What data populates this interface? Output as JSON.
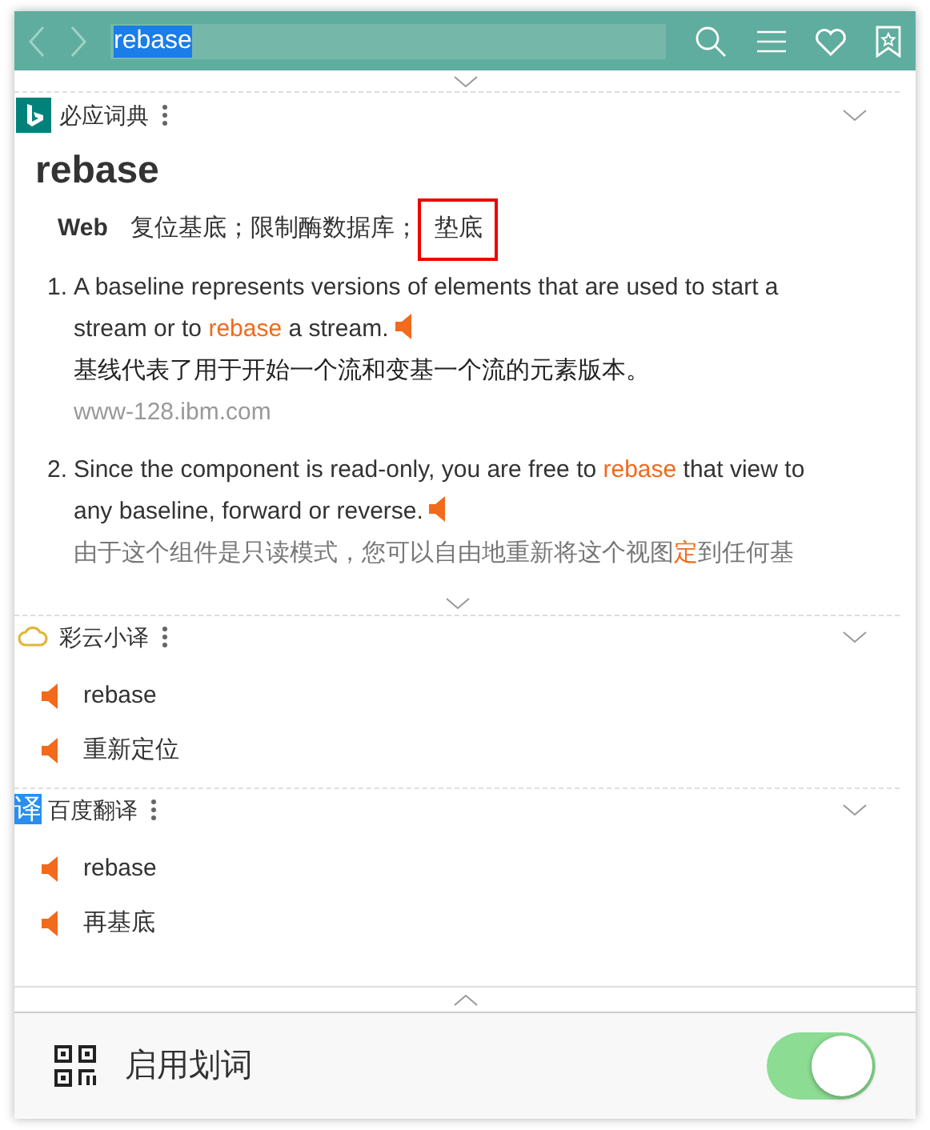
{
  "search": {
    "value": "rebase"
  },
  "dicts": [
    {
      "kind": "bing",
      "name": "必应词典",
      "word": "rebase",
      "pos": "Web",
      "meanings": [
        {
          "text": "复位基底；限制酶数据库；",
          "boxed": false
        },
        {
          "text": "垫底",
          "boxed": true
        }
      ],
      "examples": [
        {
          "number": "1.",
          "en": [
            {
              "text": "A baseline represents versions of elements that are used to start a stream or to ",
              "highlight": false
            },
            {
              "text": "rebase",
              "highlight": true
            },
            {
              "text": " a stream.",
              "highlight": false
            }
          ],
          "zh": [
            {
              "text": "基线代表了用于开始一个流和变基一个流的元素版本。",
              "highlight": false
            }
          ],
          "source": "www-128.ibm.com",
          "faded": false
        },
        {
          "number": "2.",
          "en": [
            {
              "text": "Since the component is read-only, you are free to ",
              "highlight": false
            },
            {
              "text": "rebase",
              "highlight": true
            },
            {
              "text": " that view to any baseline, forward or reverse.",
              "highlight": false
            }
          ],
          "zh": [
            {
              "text": "由于这个组件是只读模式，您可以自由地重新将这个视图",
              "highlight": false
            },
            {
              "text": "定",
              "highlight": true
            },
            {
              "text": "到任何基",
              "highlight": false
            }
          ],
          "faded": true
        }
      ]
    },
    {
      "kind": "caiyun",
      "name": "彩云小译",
      "lines": [
        "rebase",
        "重新定位"
      ]
    },
    {
      "kind": "baidu",
      "name": "百度翻译",
      "logo": "译",
      "lines": [
        "rebase",
        "再基底"
      ]
    }
  ],
  "footer": {
    "label": "启用划词",
    "on": true
  }
}
